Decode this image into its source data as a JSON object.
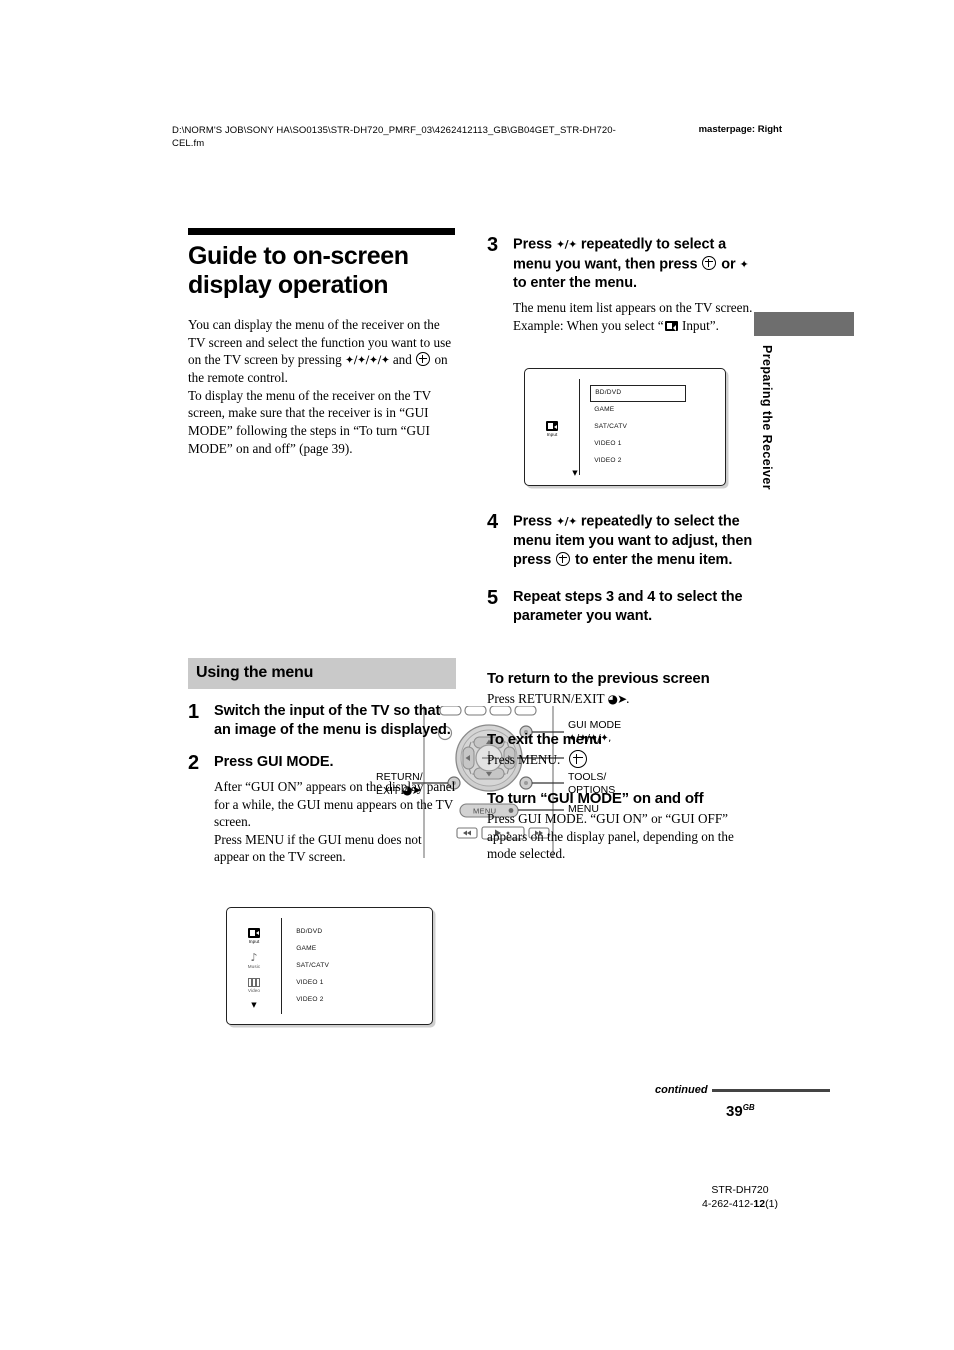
{
  "header": {
    "file_path": "D:\\NORM'S JOB\\SONY HA\\SO0135\\STR-DH720_PMRF_03\\4262412113_GB\\GB04GET_STR-DH720-CEL.fm",
    "masterpage": "masterpage: Right"
  },
  "side_tab": {
    "label": "Preparing the Receiver",
    "band_color": "#6e6e6e"
  },
  "left_column": {
    "title": "Guide to on-screen display operation",
    "intro_p1_a": "You can display the menu of the receiver on the TV screen and select the function you want to use on the TV screen by pressing ",
    "intro_arrows": "✦/✦/✦/✦",
    "intro_p1_b": " and ",
    "intro_p1_c": " on the remote control.",
    "intro_p2": "To display the menu of the receiver on the TV screen, make sure that the receiver is in “GUI MODE” following the steps in “To turn “GUI MODE” on and off” (page 39).",
    "remote_callouts": {
      "return_exit": "RETURN/ EXIT",
      "gui_mode": "GUI MODE",
      "arrows_line": "✦/✦/✦/✦,",
      "tools_options": "TOOLS/ OPTIONS",
      "menu": "MENU",
      "menu_button": "MENU"
    },
    "subhead": "Using the menu",
    "steps": [
      {
        "num": "1",
        "head": "Switch the input of the TV so that an image of the menu is displayed.",
        "desc": ""
      },
      {
        "num": "2",
        "head": "Press GUI MODE.",
        "desc_l1": "After “GUI ON” appears on the display panel for a while, the GUI menu appears on the TV screen.",
        "desc_l2": "Press MENU if the GUI menu does not appear on the TV screen."
      }
    ]
  },
  "right_column": {
    "steps": [
      {
        "num": "3",
        "head_a": "Press ",
        "head_arrows": "✦/✦",
        "head_b": " repeatedly to select a menu you want, then press ",
        "head_c": " or ",
        "head_arrow2": "✦",
        "head_d": " to enter the menu.",
        "desc_l1": "The menu item list appears on the TV screen.",
        "desc_l2_a": "Example: When you select “",
        "desc_l2_b": " Input”."
      },
      {
        "num": "4",
        "head_a": "Press ",
        "head_arrows": "✦/✦",
        "head_b": " repeatedly to select the menu item you want to adjust, then press ",
        "head_c": " to enter the menu item."
      },
      {
        "num": "5",
        "head": "Repeat steps 3 and 4 to select the parameter you want."
      }
    ],
    "minor_sections": [
      {
        "title": "To return to the previous screen",
        "body_a": "Press RETURN/EXIT ",
        "body_b": "."
      },
      {
        "title": "To exit the menu",
        "body_a": "Press MENU.",
        "body_b": ""
      },
      {
        "title": "To turn “GUI MODE” on and off",
        "body_a": "Press GUI MODE. “GUI ON” or “GUI OFF” appears on the display panel, depending on the mode selected.",
        "body_b": ""
      }
    ]
  },
  "tv_mock_left": {
    "icons": [
      {
        "name": "Input",
        "glyph": "input-icon",
        "active": true
      },
      {
        "name": "Music",
        "glyph": "music-icon",
        "active": false
      },
      {
        "name": "Video",
        "glyph": "video-icon",
        "active": false
      }
    ],
    "caret": "▼",
    "items": [
      "BD/DVD",
      "GAME",
      "SAT/CATV",
      "VIDEO 1",
      "VIDEO 2"
    ],
    "selected_index": -1
  },
  "tv_mock_right": {
    "icons": [
      {
        "name": "Input",
        "glyph": "input-icon",
        "active": true
      }
    ],
    "caret": "▼",
    "items": [
      "BD/DVD",
      "GAME",
      "SAT/CATV",
      "VIDEO 1",
      "VIDEO 2"
    ],
    "selected_index": 0
  },
  "footer": {
    "continued": "continued",
    "page_number": "39",
    "page_suffix": "GB",
    "model": "STR-DH720",
    "part_a": "4-262-412-",
    "part_b": "12",
    "part_c": "(1)"
  }
}
